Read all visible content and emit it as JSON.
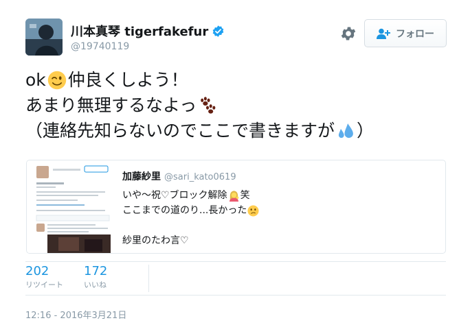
{
  "author": {
    "display_name": "川本真琴 tigerfakefur",
    "handle": "@19740119",
    "verified": true
  },
  "actions": {
    "settings_icon": "gear-icon",
    "follow_label": "フォロー",
    "follow_icon": "add-user-icon"
  },
  "tweet": {
    "line1_a": "ok",
    "line1_b": "仲良くしよう！",
    "line2": "あまり無理するなよっ",
    "line3": "（連絡先知らないのでここで書きますが",
    "line3_end": "）",
    "emoji": [
      "winking-face-emoji",
      "paw-prints-emoji",
      "sweat-droplets-emoji"
    ]
  },
  "quote": {
    "name": "加藤紗里",
    "handle": "@sari_kato0619",
    "line1_a": "いや〜祝♡ブロック解除",
    "line1_b": "笑",
    "line2": "ここまでの道のり...長かった",
    "line3": "紗里のたわ言♡",
    "emoji": [
      "woman-tipping-hand-emoji",
      "confused-face-emoji"
    ]
  },
  "stats": {
    "retweets": "202",
    "retweets_label": "リツイート",
    "likes": "172",
    "likes_label": "いいね"
  },
  "timestamp": "12:16 - 2016年3月21日",
  "colors": {
    "link_blue": "#1b95e0",
    "muted": "#8899a6",
    "border": "#e1e8ed",
    "verified": "#1da1f2"
  }
}
